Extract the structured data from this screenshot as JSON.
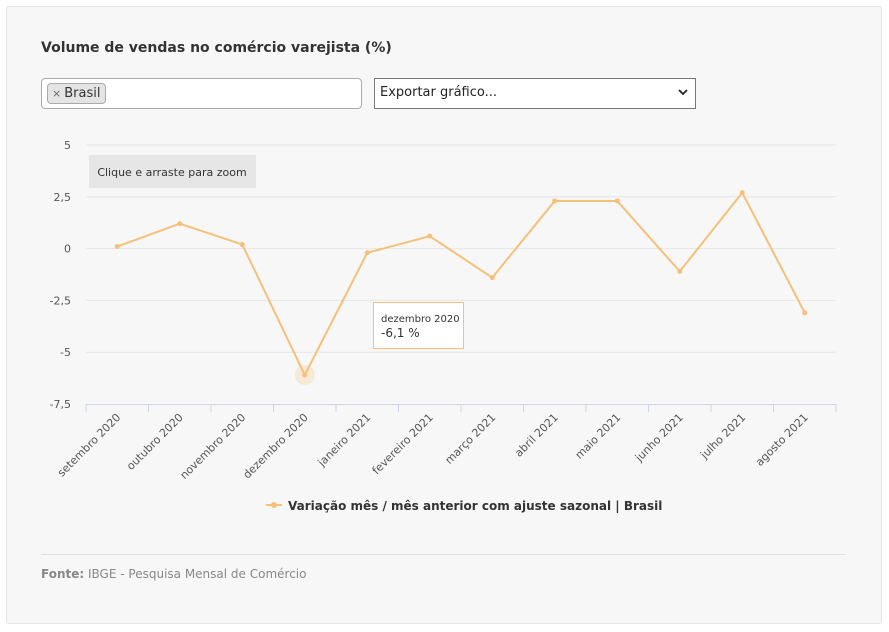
{
  "header": {
    "title": "Volume de vendas no comércio varejista (%)"
  },
  "filter": {
    "tag_remove": "×",
    "tag_label": "Brasil"
  },
  "export": {
    "label": "Exportar gráfico..."
  },
  "zoom_hint": "Clique e arraste para zoom",
  "tooltip": {
    "label": "dezembro 2020",
    "value": "-6,1 %"
  },
  "footer": {
    "source_label": "Fonte:",
    "source_text": "IBGE - Pesquisa Mensal de Comércio"
  },
  "chart_data": {
    "type": "line",
    "categories": [
      "setembro 2020",
      "outubro 2020",
      "novembro 2020",
      "dezembro 2020",
      "janeiro 2021",
      "fevereiro 2021",
      "março 2021",
      "abril 2021",
      "maio 2021",
      "junho 2021",
      "julho 2021",
      "agosto 2021"
    ],
    "series": [
      {
        "name": "Variação mês / mês anterior com ajuste sazonal | Brasil",
        "values": [
          0.1,
          1.2,
          0.2,
          -6.1,
          -0.2,
          0.6,
          -1.4,
          2.3,
          2.3,
          -1.1,
          2.7,
          -3.1
        ],
        "color": "#f5c07a"
      }
    ],
    "ylim": [
      -7.5,
      5
    ],
    "yticks": [
      5,
      2.5,
      0,
      -2.5,
      -5,
      -7.5
    ],
    "ytick_labels": [
      "5",
      "2,5",
      "0",
      "-2,5",
      "-5",
      "-7,5"
    ],
    "highlight_index": 3,
    "grid": true,
    "legend": "bottom-center"
  }
}
